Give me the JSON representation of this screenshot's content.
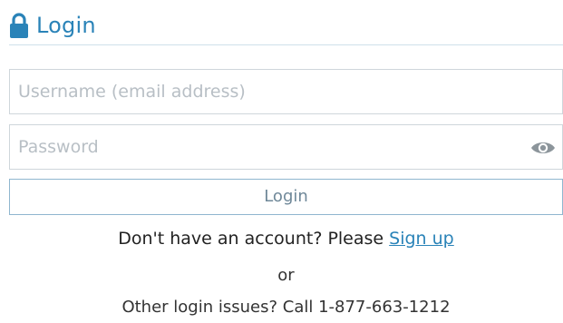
{
  "header": {
    "icon": "lock-icon",
    "title": "Login"
  },
  "form": {
    "username": {
      "value": "",
      "placeholder": "Username (email address)"
    },
    "password": {
      "value": "",
      "placeholder": "Password",
      "toggle_icon": "eye-icon"
    },
    "login_button_label": "Login"
  },
  "footer": {
    "signup_prompt": "Don't have an account? Please",
    "signup_link": "Sign up",
    "or_text": "or",
    "issues_text": "Other login issues? Call 1-877-663-1212"
  },
  "colors": {
    "accent": "#2a83b8",
    "border": "#cfd6db",
    "button_border": "#8fb6cf",
    "placeholder": "#b8bfc5"
  }
}
